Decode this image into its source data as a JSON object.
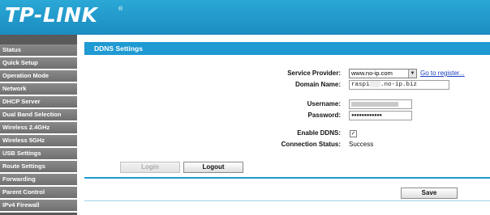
{
  "brand": {
    "logo_text": "TP-LINK",
    "registered_mark": "®"
  },
  "sidebar": {
    "items": [
      {
        "label": "Status"
      },
      {
        "label": "Quick Setup"
      },
      {
        "label": "Operation Mode"
      },
      {
        "label": "Network"
      },
      {
        "label": "DHCP Server"
      },
      {
        "label": "Dual Band Selection"
      },
      {
        "label": "Wireless 2.4GHz"
      },
      {
        "label": "Wireless 5GHz"
      },
      {
        "label": "USB Settings"
      },
      {
        "label": "Route Settings"
      },
      {
        "label": "Forwarding"
      },
      {
        "label": "Parent Control"
      },
      {
        "label": "IPv4 Firewall"
      }
    ]
  },
  "page": {
    "title": "DDNS Settings"
  },
  "form": {
    "service_provider": {
      "label": "Service Provider:",
      "value": "www.no-ip.com",
      "register_link": "Go to register..."
    },
    "domain_name": {
      "label": "Domain Name:",
      "value_prefix": "raspi",
      "value_suffix": ".no-ip.biz"
    },
    "username": {
      "label": "Username:"
    },
    "password": {
      "label": "Password:",
      "value": "●●●●●●●●●●●●"
    },
    "enable_ddns": {
      "label": "Enable DDNS:",
      "checked_mark": "✓"
    },
    "connection_status": {
      "label": "Connection Status:",
      "value": "Success"
    }
  },
  "buttons": {
    "login": "Login",
    "logout": "Logout",
    "save": "Save"
  },
  "colors": {
    "header": "#1f9ad2",
    "sidebar": "#6f6f6f",
    "accent": "#1f9ad2",
    "link": "#1a3fbf"
  }
}
